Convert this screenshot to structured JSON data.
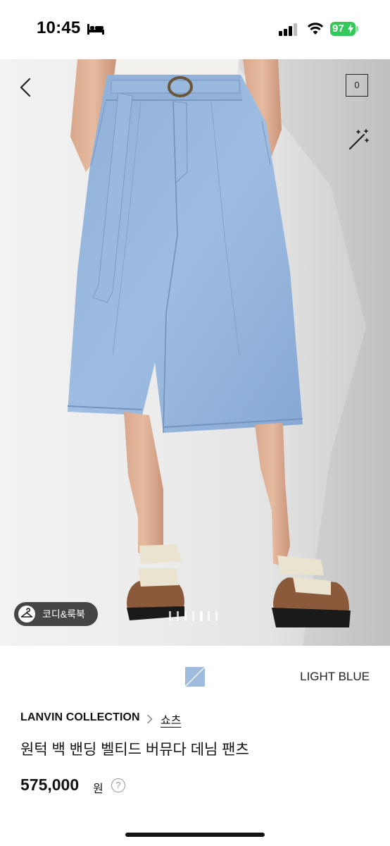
{
  "status_bar": {
    "time": "10:45",
    "battery": "97",
    "icons": [
      "bed-icon",
      "signal-icon",
      "wifi-icon",
      "battery-icon"
    ]
  },
  "gallery": {
    "cart_count": "0",
    "look_button_label": "코디&룩북",
    "current_image": 5,
    "image_count": 7,
    "icons": [
      "back-arrow-icon",
      "magic-wand-icon",
      "hanger-icon"
    ]
  },
  "product": {
    "color_name": "LIGHT BLUE",
    "brand": "LANVIN COLLECTION",
    "category": "쇼츠",
    "title": "원턱 백 밴딩 벨티드 버뮤다 데님 팬츠",
    "price": "575,000",
    "currency": "원",
    "help_symbol": "?"
  },
  "colors": {
    "accent_green": "#34c759",
    "denim": "#8fb1d9",
    "text": "#111111"
  }
}
